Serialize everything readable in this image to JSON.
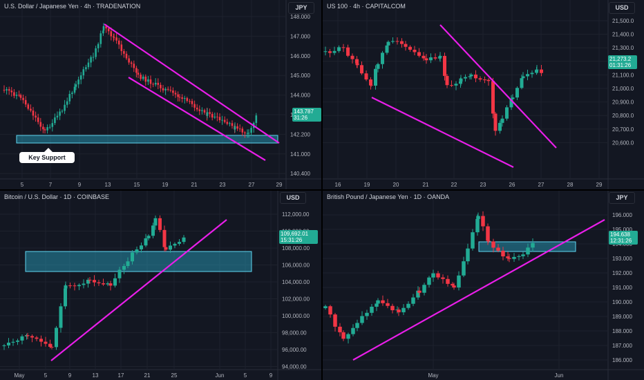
{
  "colors": {
    "up": "#22ab94",
    "down": "#f23645",
    "trend": "#e91ee9",
    "zone": "#2ba8c8",
    "bg": "#131722"
  },
  "panels": [
    {
      "id": "usdjpy",
      "title": "U.S. Dollar / Japanese Yen · 4h · TRADENATION",
      "currency": "JPY",
      "price_axis": [
        "148.000",
        "147.000",
        "146.000",
        "145.000",
        "144.000",
        "143.000",
        "142.200",
        "141.000",
        "140.400"
      ],
      "time_axis": [
        "5",
        "7",
        "9",
        "13",
        "15",
        "19",
        "21",
        "23",
        "27",
        "29"
      ],
      "last_price": "143.787",
      "countdown": "31:26",
      "annotation": "Key Support"
    },
    {
      "id": "us100",
      "title": "US 100 · 4h · CAPITALCOM",
      "currency": "USD",
      "price_axis": [
        "21,500.0",
        "21,400.0",
        "21,300.0",
        "21,200.0",
        "21,100.0",
        "21,000.0",
        "20,900.0",
        "20,800.0",
        "20,700.0",
        "20,600.0"
      ],
      "time_axis": [
        "16",
        "19",
        "20",
        "21",
        "22",
        "23",
        "26",
        "27",
        "28",
        "29"
      ],
      "last_price": "21,273.2",
      "countdown": "01:31:26"
    },
    {
      "id": "btcusd",
      "title": "Bitcoin / U.S. Dollar · 1D · COINBASE",
      "currency": "USD",
      "price_axis": [
        "112,000.00",
        "110,000.00",
        "108,000.00",
        "106,000.00",
        "104,000.00",
        "102,000.00",
        "100,000.00",
        "98,000.00",
        "96,000.00",
        "94,000.00"
      ],
      "time_axis": [
        "May",
        "5",
        "9",
        "13",
        "17",
        "21",
        "25",
        "Jun",
        "5",
        "9"
      ],
      "last_price": "109,692.01",
      "countdown": "15:31:26"
    },
    {
      "id": "gbpjpy",
      "title": "British Pound / Japanese Yen · 1D · OANDA",
      "currency": "JPY",
      "price_axis": [
        "196.000",
        "195.000",
        "194.000",
        "193.000",
        "192.000",
        "191.000",
        "190.000",
        "189.000",
        "188.000",
        "187.000",
        "186.000"
      ],
      "time_axis": [
        "May",
        "Jun"
      ],
      "last_price": "194.638",
      "countdown": "12:31:26"
    }
  ]
}
